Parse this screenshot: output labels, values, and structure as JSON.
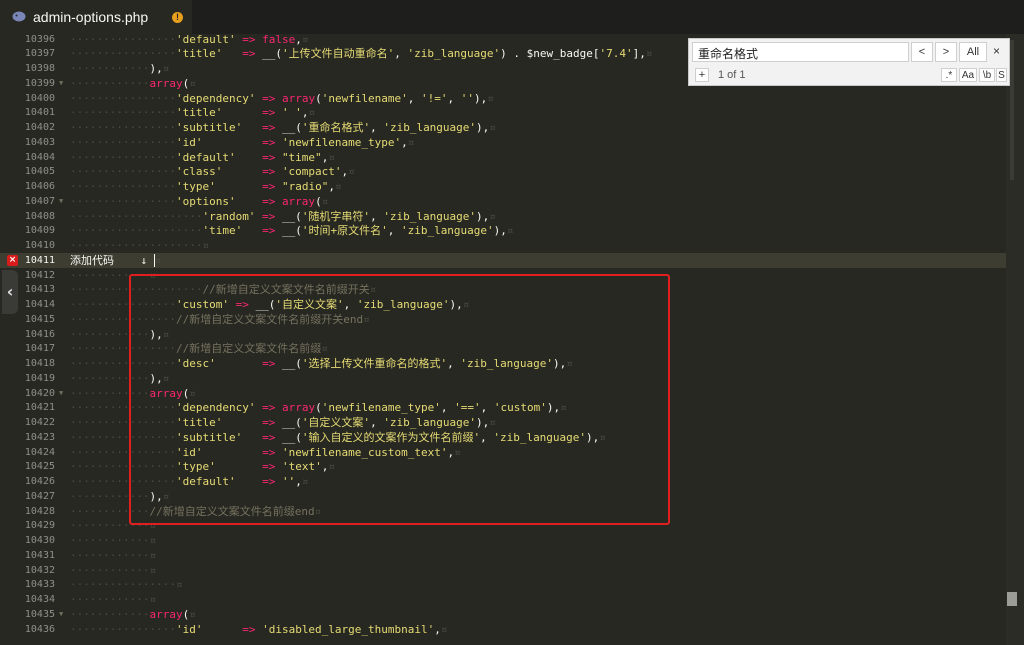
{
  "tab": {
    "filename": "admin-options.php",
    "dirty_marker": "!"
  },
  "find": {
    "query": "重命名格式",
    "prev_symbol": "<",
    "next_symbol": ">",
    "all_label": "All",
    "close_symbol": "×",
    "plus_symbol": "+",
    "count_text": "1 of 1",
    "regex_label": ".*",
    "case_label": "Aa",
    "word_label": "\\b",
    "selection_label": "S"
  },
  "editor": {
    "error_marker": "×",
    "lines": [
      {
        "num": "10396",
        "ind": 4,
        "tokens": [
          [
            "'default'",
            "s"
          ],
          [
            " => ",
            "k"
          ],
          [
            "false",
            "k"
          ],
          [
            ",",
            "v"
          ]
        ]
      },
      {
        "num": "10397",
        "ind": 4,
        "tokens": [
          [
            "'title'",
            "s"
          ],
          [
            "   => ",
            "k"
          ],
          [
            "__(",
            "v"
          ],
          [
            "'上传文件自动重命名'",
            "s"
          ],
          [
            ", ",
            "v"
          ],
          [
            "'zib_language'",
            "s"
          ],
          [
            ") . ",
            "v"
          ],
          [
            "$new_badge",
            "v"
          ],
          [
            "[",
            "v"
          ],
          [
            "'7.4'",
            "s"
          ],
          [
            "],",
            "v"
          ]
        ]
      },
      {
        "num": "10398",
        "ind": 3,
        "tokens": [
          [
            "),",
            "v"
          ]
        ]
      },
      {
        "num": "10399",
        "ind": 3,
        "fold": true,
        "tokens": [
          [
            "array",
            "k"
          ],
          [
            "(",
            "v"
          ]
        ]
      },
      {
        "num": "10400",
        "ind": 4,
        "tokens": [
          [
            "'dependency'",
            "s"
          ],
          [
            " => ",
            "k"
          ],
          [
            "array",
            "k"
          ],
          [
            "(",
            "v"
          ],
          [
            "'newfilename'",
            "s"
          ],
          [
            ", ",
            "v"
          ],
          [
            "'!='",
            "s"
          ],
          [
            ", ",
            "v"
          ],
          [
            "''",
            "s"
          ],
          [
            "),",
            "v"
          ]
        ]
      },
      {
        "num": "10401",
        "ind": 4,
        "tokens": [
          [
            "'title'",
            "s"
          ],
          [
            "      => ",
            "k"
          ],
          [
            "' '",
            "s"
          ],
          [
            ",",
            "v"
          ]
        ]
      },
      {
        "num": "10402",
        "ind": 4,
        "tokens": [
          [
            "'subtitle'",
            "s"
          ],
          [
            "   => ",
            "k"
          ],
          [
            "__(",
            "v"
          ],
          [
            "'重命名格式'",
            "s"
          ],
          [
            ", ",
            "v"
          ],
          [
            "'zib_language'",
            "s"
          ],
          [
            "),",
            "v"
          ]
        ]
      },
      {
        "num": "10403",
        "ind": 4,
        "tokens": [
          [
            "'id'",
            "s"
          ],
          [
            "         => ",
            "k"
          ],
          [
            "'newfilename_type'",
            "s"
          ],
          [
            ",",
            "v"
          ]
        ]
      },
      {
        "num": "10404",
        "ind": 4,
        "tokens": [
          [
            "'default'",
            "s"
          ],
          [
            "    => ",
            "k"
          ],
          [
            "\"time\"",
            "s"
          ],
          [
            ",",
            "v"
          ]
        ]
      },
      {
        "num": "10405",
        "ind": 4,
        "tokens": [
          [
            "'class'",
            "s"
          ],
          [
            "      => ",
            "k"
          ],
          [
            "'compact'",
            "s"
          ],
          [
            ",",
            "v"
          ]
        ]
      },
      {
        "num": "10406",
        "ind": 4,
        "tokens": [
          [
            "'type'",
            "s"
          ],
          [
            "       => ",
            "k"
          ],
          [
            "\"radio\"",
            "s"
          ],
          [
            ",",
            "v"
          ]
        ]
      },
      {
        "num": "10407",
        "ind": 4,
        "fold": true,
        "tokens": [
          [
            "'options'",
            "s"
          ],
          [
            "    => ",
            "k"
          ],
          [
            "array",
            "k"
          ],
          [
            "(",
            "v"
          ]
        ]
      },
      {
        "num": "10408",
        "ind": 5,
        "tokens": [
          [
            "'random'",
            "s"
          ],
          [
            " => ",
            "k"
          ],
          [
            "__(",
            "v"
          ],
          [
            "'随机字串符'",
            "s"
          ],
          [
            ", ",
            "v"
          ],
          [
            "'zib_language'",
            "s"
          ],
          [
            "),",
            "v"
          ]
        ]
      },
      {
        "num": "10409",
        "ind": 5,
        "tokens": [
          [
            "'time'",
            "s"
          ],
          [
            "   => ",
            "k"
          ],
          [
            "__(",
            "v"
          ],
          [
            "'时间+原文件名'",
            "s"
          ],
          [
            ", ",
            "v"
          ],
          [
            "'zib_language'",
            "s"
          ],
          [
            "),",
            "v"
          ]
        ]
      },
      {
        "num": "10410",
        "ind": 5,
        "tokens": []
      },
      {
        "num": "10411",
        "ind": 0,
        "err": true,
        "cur": true,
        "tokens": [
          [
            "添加代码",
            "v"
          ],
          [
            "    ↓ ",
            "v"
          ]
        ],
        "caret": true
      },
      {
        "num": "10412",
        "ind": 3,
        "tokens": []
      },
      {
        "num": "10413",
        "ind": 5,
        "tokens": [
          [
            "//新增自定义文案文件名前缀开关",
            "c"
          ]
        ]
      },
      {
        "num": "10414",
        "ind": 4,
        "tokens": [
          [
            "'custom'",
            "s"
          ],
          [
            " => ",
            "k"
          ],
          [
            "__(",
            "v"
          ],
          [
            "'自定义文案'",
            "s"
          ],
          [
            ", ",
            "v"
          ],
          [
            "'zib_language'",
            "s"
          ],
          [
            "),",
            "v"
          ]
        ]
      },
      {
        "num": "10415",
        "ind": 4,
        "tokens": [
          [
            "//新增自定义文案文件名前缀开关end",
            "c"
          ]
        ]
      },
      {
        "num": "10416",
        "ind": 3,
        "tokens": [
          [
            "),",
            "v"
          ]
        ]
      },
      {
        "num": "10417",
        "ind": 4,
        "tokens": [
          [
            "//新增自定义文案文件名前缀",
            "c"
          ]
        ]
      },
      {
        "num": "10418",
        "ind": 4,
        "tokens": [
          [
            "'desc'",
            "s"
          ],
          [
            "       => ",
            "k"
          ],
          [
            "__(",
            "v"
          ],
          [
            "'选择上传文件重命名的格式'",
            "s"
          ],
          [
            ", ",
            "v"
          ],
          [
            "'zib_language'",
            "s"
          ],
          [
            "),",
            "v"
          ]
        ]
      },
      {
        "num": "10419",
        "ind": 3,
        "tokens": [
          [
            "),",
            "v"
          ]
        ]
      },
      {
        "num": "10420",
        "ind": 3,
        "fold": true,
        "tokens": [
          [
            "array",
            "k"
          ],
          [
            "(",
            "v"
          ]
        ]
      },
      {
        "num": "10421",
        "ind": 4,
        "tokens": [
          [
            "'dependency'",
            "s"
          ],
          [
            " => ",
            "k"
          ],
          [
            "array",
            "k"
          ],
          [
            "(",
            "v"
          ],
          [
            "'newfilename_type'",
            "s"
          ],
          [
            ", ",
            "v"
          ],
          [
            "'=='",
            "s"
          ],
          [
            ", ",
            "v"
          ],
          [
            "'custom'",
            "s"
          ],
          [
            "),",
            "v"
          ]
        ]
      },
      {
        "num": "10422",
        "ind": 4,
        "tokens": [
          [
            "'title'",
            "s"
          ],
          [
            "      => ",
            "k"
          ],
          [
            "__(",
            "v"
          ],
          [
            "'自定义文案'",
            "s"
          ],
          [
            ", ",
            "v"
          ],
          [
            "'zib_language'",
            "s"
          ],
          [
            "),",
            "v"
          ]
        ]
      },
      {
        "num": "10423",
        "ind": 4,
        "tokens": [
          [
            "'subtitle'",
            "s"
          ],
          [
            "   => ",
            "k"
          ],
          [
            "__(",
            "v"
          ],
          [
            "'输入自定义的文案作为文件名前缀'",
            "s"
          ],
          [
            ", ",
            "v"
          ],
          [
            "'zib_language'",
            "s"
          ],
          [
            "),",
            "v"
          ]
        ]
      },
      {
        "num": "10424",
        "ind": 4,
        "tokens": [
          [
            "'id'",
            "s"
          ],
          [
            "         => ",
            "k"
          ],
          [
            "'newfilename_custom_text'",
            "s"
          ],
          [
            ",",
            "v"
          ]
        ]
      },
      {
        "num": "10425",
        "ind": 4,
        "tokens": [
          [
            "'type'",
            "s"
          ],
          [
            "       => ",
            "k"
          ],
          [
            "'text'",
            "s"
          ],
          [
            ",",
            "v"
          ]
        ]
      },
      {
        "num": "10426",
        "ind": 4,
        "tokens": [
          [
            "'default'",
            "s"
          ],
          [
            "    => ",
            "k"
          ],
          [
            "''",
            "s"
          ],
          [
            ",",
            "v"
          ]
        ]
      },
      {
        "num": "10427",
        "ind": 3,
        "tokens": [
          [
            "),",
            "v"
          ]
        ]
      },
      {
        "num": "10428",
        "ind": 3,
        "tokens": [
          [
            "//新增自定义文案文件名前缀end",
            "c"
          ]
        ]
      },
      {
        "num": "10429",
        "ind": 3,
        "tokens": []
      },
      {
        "num": "10430",
        "ind": 3,
        "tokens": []
      },
      {
        "num": "10431",
        "ind": 3,
        "tokens": []
      },
      {
        "num": "10432",
        "ind": 3,
        "tokens": []
      },
      {
        "num": "10433",
        "ind": 4,
        "tokens": []
      },
      {
        "num": "10434",
        "ind": 3,
        "tokens": []
      },
      {
        "num": "10435",
        "ind": 3,
        "fold": true,
        "tokens": [
          [
            "array",
            "k"
          ],
          [
            "(",
            "v"
          ]
        ]
      },
      {
        "num": "10436",
        "ind": 4,
        "tokens": [
          [
            "'id'",
            "s"
          ],
          [
            "      => ",
            "k"
          ],
          [
            "'disabled_large_thumbnail'",
            "s"
          ],
          [
            ",",
            "v"
          ]
        ]
      }
    ]
  }
}
